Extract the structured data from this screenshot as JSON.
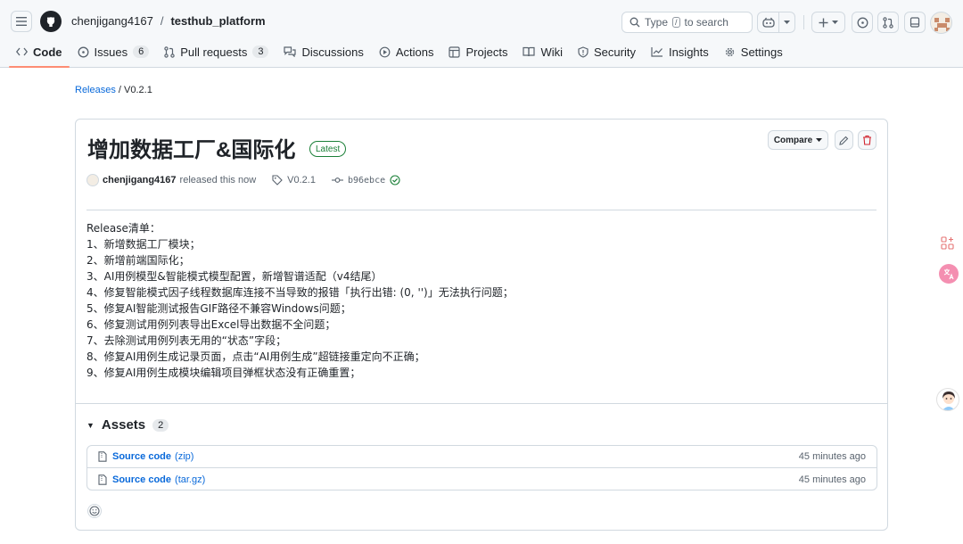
{
  "header": {
    "owner": "chenjigang4167",
    "separator": "/",
    "repo": "testhub_platform",
    "search_type": "Type",
    "search_key": "/",
    "search_to": "to search"
  },
  "tabs": [
    {
      "label": "Code",
      "icon": "code-icon",
      "active": true
    },
    {
      "label": "Issues",
      "icon": "issue-icon",
      "count": "6"
    },
    {
      "label": "Pull requests",
      "icon": "pull-request-icon",
      "count": "3"
    },
    {
      "label": "Discussions",
      "icon": "discussions-icon"
    },
    {
      "label": "Actions",
      "icon": "play-icon"
    },
    {
      "label": "Projects",
      "icon": "table-icon"
    },
    {
      "label": "Wiki",
      "icon": "book-icon"
    },
    {
      "label": "Security",
      "icon": "shield-icon"
    },
    {
      "label": "Insights",
      "icon": "graph-icon"
    },
    {
      "label": "Settings",
      "icon": "gear-icon"
    }
  ],
  "breadcrumb": {
    "releases": "Releases",
    "sep": "/",
    "current": "V0.2.1"
  },
  "release": {
    "title": "增加数据工厂&国际化",
    "badge": "Latest",
    "compare_label": "Compare",
    "author": "chenjigang4167",
    "released_text": "released this now",
    "tag": "V0.2.1",
    "commit": "b96ebce",
    "notes": [
      "Release清单：",
      "1、新增数据工厂模块；",
      "2、新增前端国际化；",
      "3、AI用例模型&智能模式模型配置，新增智谱适配（v4结尾）",
      "4、修复智能模式因子线程数据库连接不当导致的报错「执行出错: (0, '')」无法执行问题；",
      "5、修复AI智能测试报告GIF路径不兼容Windows问题；",
      "6、修复测试用例列表导出Excel导出数据不全问题；",
      "7、去除测试用例列表无用的“状态”字段；",
      "8、修复AI用例生成记录页面，点击“AI用例生成”超链接重定向不正确；",
      "9、修复AI用例生成模块编辑项目弹框状态没有正确重置；"
    ]
  },
  "assets": {
    "label": "Assets",
    "count": "2",
    "items": [
      {
        "name": "Source code",
        "kind": "(zip)",
        "time": "45 minutes ago"
      },
      {
        "name": "Source code",
        "kind": "(tar.gz)",
        "time": "45 minutes ago"
      }
    ]
  },
  "colors": {
    "accent": "#0969da",
    "latest": "#1a7f37",
    "active_tab_underline": "#fd8c73",
    "danger": "#d1242f"
  }
}
